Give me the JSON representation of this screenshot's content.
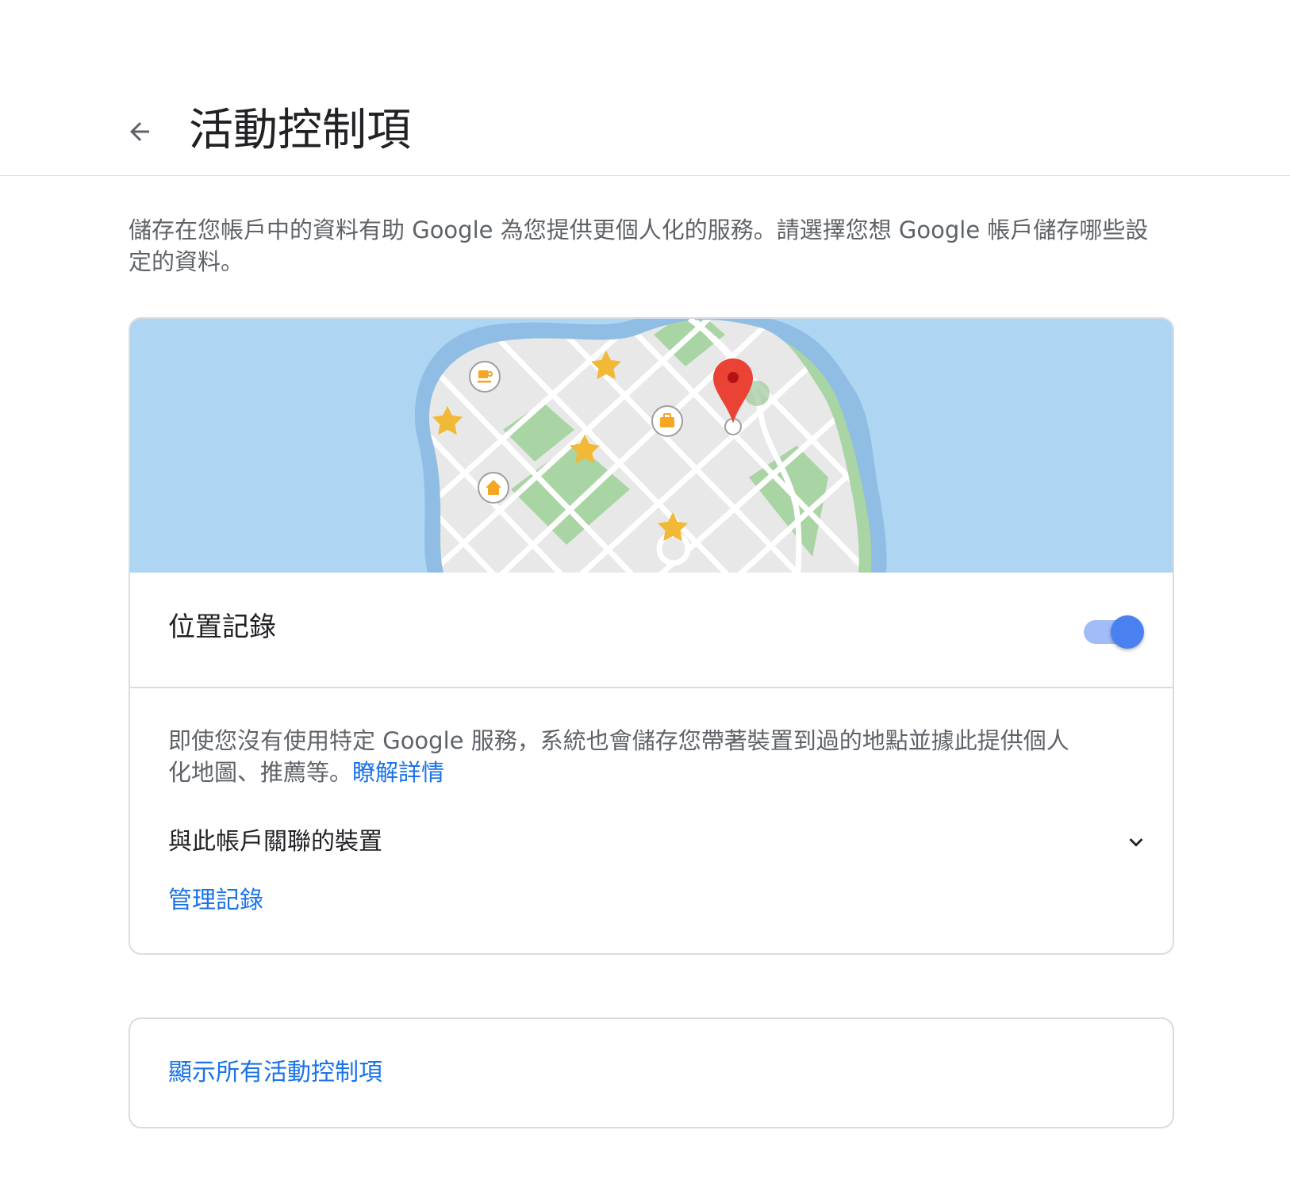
{
  "header": {
    "title": "活動控制項",
    "back_icon": "arrow-back-icon"
  },
  "intro": {
    "text": "儲存在您帳戶中的資料有助 Google 為您提供更個人化的服務。請選擇您想 Google 帳戶儲存哪些設定的資料。"
  },
  "location_history": {
    "title": "位置記錄",
    "toggle_on": true,
    "description": "即使您沒有使用特定 Google 服務，系統也會儲存您帶著裝置到過的地點並據此提供個人化地圖、推薦等。",
    "learn_more": "瞭解詳情",
    "devices_label": "與此帳戶關聯的裝置",
    "manage_label": "管理記錄"
  },
  "show_all": {
    "label": "顯示所有活動控制項"
  },
  "map_icons": [
    "coffee-icon",
    "briefcase-icon",
    "home-icon",
    "star-icon",
    "location-pin-icon"
  ],
  "colors": {
    "accent": "#1a73e8",
    "toggle_knob": "#4a80f0",
    "toggle_track": "#a1bcf7",
    "water": "#aed5f2",
    "land": "#e8e8e8",
    "park": "#a8d5a3",
    "star": "#f1b935",
    "pin": "#ea4335"
  }
}
